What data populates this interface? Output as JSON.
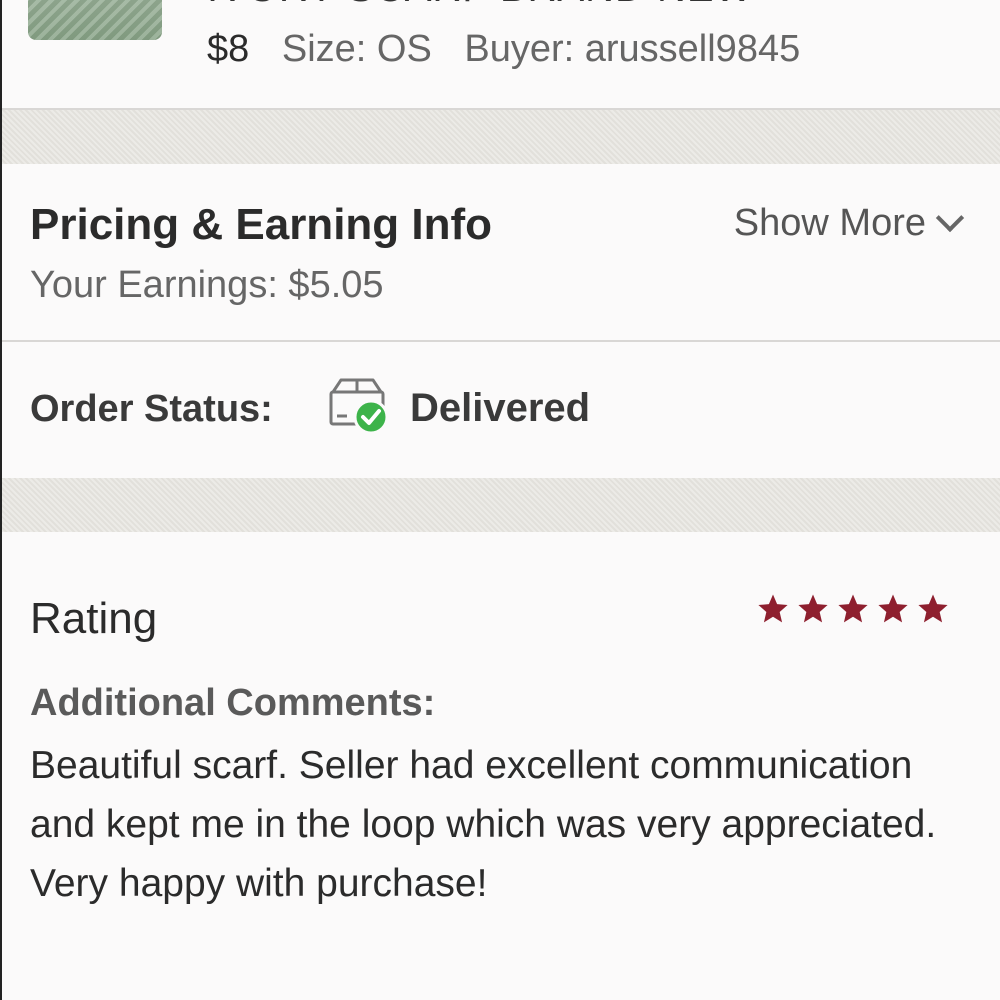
{
  "item": {
    "title": "IVORY SCARF BRAND NEW",
    "price": "$8",
    "size": "Size: OS",
    "buyer": "Buyer: arussell9845"
  },
  "pricing": {
    "title": "Pricing & Earning Info",
    "show_more": "Show More",
    "earnings": "Your Earnings: $5.05"
  },
  "order_status": {
    "label": "Order Status:",
    "value": "Delivered",
    "icon": "box-check-icon",
    "status_color": "#3db34a"
  },
  "rating": {
    "title": "Rating",
    "stars": 5,
    "star_color": "#8e1f2e",
    "comments_label": "Additional Comments:",
    "comments": "Beautiful scarf. Seller had excellent communication and kept me in the loop which was very appreciated. Very happy with purchase!"
  }
}
